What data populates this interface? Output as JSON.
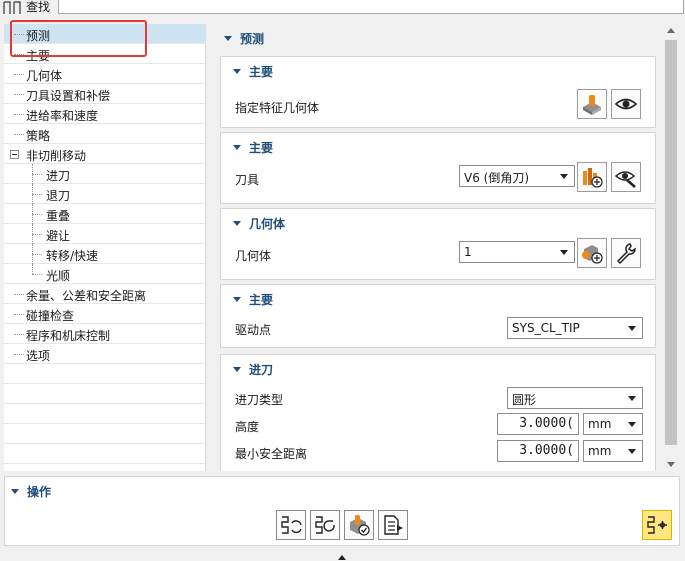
{
  "search": {
    "label": "查找",
    "value": ""
  },
  "tree": {
    "items": [
      {
        "label": "预测",
        "selected": true
      },
      {
        "label": "主要"
      },
      {
        "label": "几何体"
      },
      {
        "label": "刀具设置和补偿"
      },
      {
        "label": "进给率和速度"
      },
      {
        "label": "策略"
      },
      {
        "label": "非切削移动",
        "expanded": true
      },
      {
        "label": "进刀",
        "child": true
      },
      {
        "label": "退刀",
        "child": true
      },
      {
        "label": "重叠",
        "child": true
      },
      {
        "label": "避让",
        "child": true
      },
      {
        "label": "转移/快速",
        "child": true
      },
      {
        "label": "光顺",
        "child": true
      },
      {
        "label": "余量、公差和安全距离"
      },
      {
        "label": "碰撞检查"
      },
      {
        "label": "程序和机床控制"
      },
      {
        "label": "选项"
      }
    ]
  },
  "panel": {
    "header": "预测",
    "group1": {
      "title": "主要",
      "field_label": "指定特征几何体"
    },
    "group2": {
      "title": "主要",
      "field_label": "刀具",
      "combo_value": "V6 (倒角刀)"
    },
    "group3": {
      "title": "几何体",
      "field_label": "几何体",
      "combo_value": "1"
    },
    "group4": {
      "title": "主要",
      "field_label": "驱动点",
      "combo_value": "SYS_CL_TIP"
    },
    "group5": {
      "title": "进刀",
      "type_label": "进刀类型",
      "type_value": "圆形",
      "height_label": "高度",
      "height_value": "3.0000(",
      "height_unit": "mm",
      "min_clear_label": "最小安全距离",
      "min_clear_value": "3.0000(",
      "min_clear_unit": "mm"
    }
  },
  "actions": {
    "title": "操作"
  },
  "colors": {
    "header_blue": "#1f4e79",
    "selection": "#cfe4f3",
    "annotation_red": "#e53935",
    "highlight": "#ffe680"
  }
}
